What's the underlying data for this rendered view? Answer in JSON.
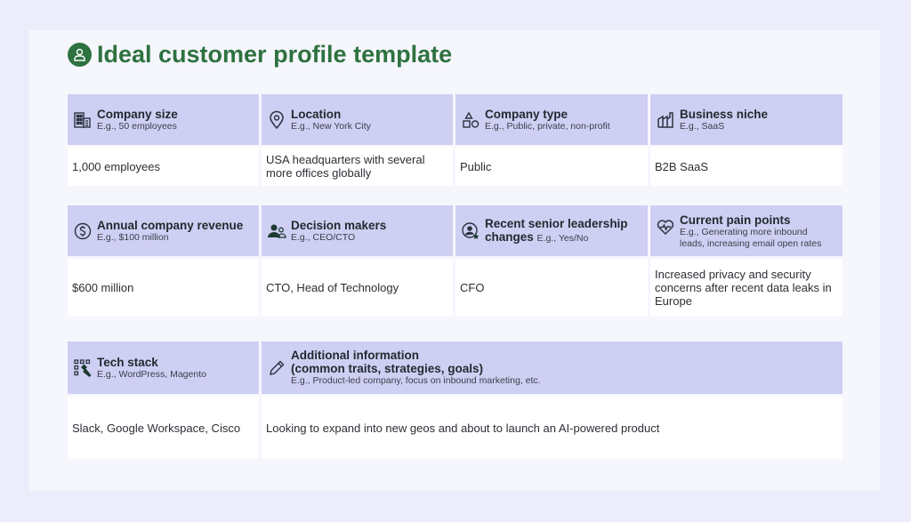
{
  "title": "Ideal customer profile template",
  "colors": {
    "accent_green": "#2e7240",
    "header_bg": "#cfcff3",
    "page_bg": "#ececfb",
    "card_bg": "#f6f6fd"
  },
  "rows": [
    {
      "cells": [
        {
          "icon": "building-icon",
          "label": "Company size",
          "example": "E.g., 50 employees",
          "value": "1,000 employees"
        },
        {
          "icon": "location-pin-icon",
          "label": "Location",
          "example": "E.g., New York City",
          "value": "USA headquarters with several more offices globally"
        },
        {
          "icon": "shapes-icon",
          "label": "Company type",
          "example": "E.g., Public, private, non-profit",
          "value": "Public"
        },
        {
          "icon": "factory-icon",
          "label": "Business niche",
          "example": "E.g., SaaS",
          "value": "B2B SaaS"
        }
      ]
    },
    {
      "cells": [
        {
          "icon": "dollar-circle-icon",
          "label": "Annual company revenue",
          "example": "E.g., $100 million",
          "value": "$600 million"
        },
        {
          "icon": "people-icon",
          "label": "Decision makers",
          "example": "E.g., CEO/CTO",
          "value": "CTO, Head of Technology"
        },
        {
          "icon": "user-star-icon",
          "label": "Recent senior leadership",
          "label_line2": "changes",
          "example": "E.g., Yes/No",
          "value": "CFO"
        },
        {
          "icon": "heart-pulse-icon",
          "label": "Current pain points",
          "example": "E.g., Generating more inbound",
          "example_line2": "leads, increasing email open rates",
          "value": "Increased privacy and security concerns after recent data leaks in Europe"
        }
      ]
    },
    {
      "cells": [
        {
          "icon": "tech-tools-icon",
          "label": "Tech stack",
          "example": "E.g., WordPress, Magento",
          "value": "Slack, Google Workspace, Cisco"
        },
        {
          "icon": "pencil-icon",
          "label": "Additional information",
          "label_line2": "(common traits, strategies, goals)",
          "example": "E.g., Product-led company, focus on inbound marketing, etc.",
          "value": "Looking to expand into new geos and about to launch an AI-powered product"
        }
      ]
    }
  ]
}
